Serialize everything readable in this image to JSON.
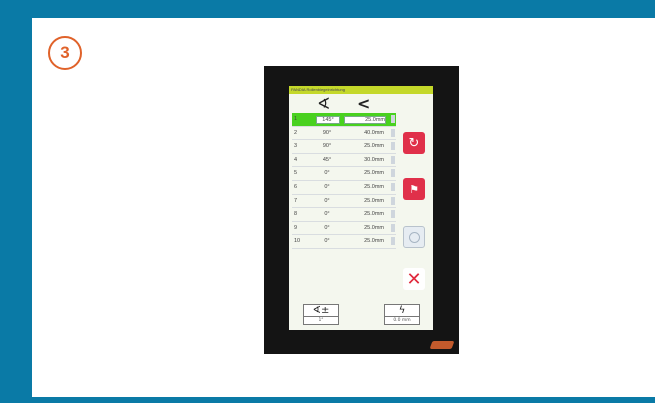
{
  "step": {
    "number": "3"
  },
  "device": {
    "title": "PANDIA Rollenbiegeinrichtung",
    "column_icons": [
      "angle-icon",
      "bend-icon"
    ],
    "rows": [
      {
        "index": "1",
        "angle": "145°",
        "length": "25.0mm",
        "selected": true
      },
      {
        "index": "2",
        "angle": "90°",
        "length": "40.0mm",
        "selected": false
      },
      {
        "index": "3",
        "angle": "90°",
        "length": "25.0mm",
        "selected": false
      },
      {
        "index": "4",
        "angle": "45°",
        "length": "30.0mm",
        "selected": false
      },
      {
        "index": "5",
        "angle": "0°",
        "length": "25.0mm",
        "selected": false
      },
      {
        "index": "6",
        "angle": "0°",
        "length": "25.0mm",
        "selected": false
      },
      {
        "index": "7",
        "angle": "0°",
        "length": "25.0mm",
        "selected": false
      },
      {
        "index": "8",
        "angle": "0°",
        "length": "25.0mm",
        "selected": false
      },
      {
        "index": "9",
        "angle": "0°",
        "length": "25.0mm",
        "selected": false
      },
      {
        "index": "10",
        "angle": "0°",
        "length": "25.0mm",
        "selected": false
      }
    ],
    "side_buttons": {
      "undo_icon": "undo-icon",
      "flag_icon": "flag-icon",
      "blank_icon": "blank-icon",
      "delete_icon": "delete-icon"
    },
    "bottom_buttons": {
      "angle_sub": "1°",
      "bend_sub": "0.0  mm"
    }
  },
  "colors": {
    "frame": "#0a7aa6",
    "badge": "#e0622a",
    "selected_row": "#49d11f",
    "title_bar": "#c4d82a",
    "action_red": "#e0304a"
  }
}
